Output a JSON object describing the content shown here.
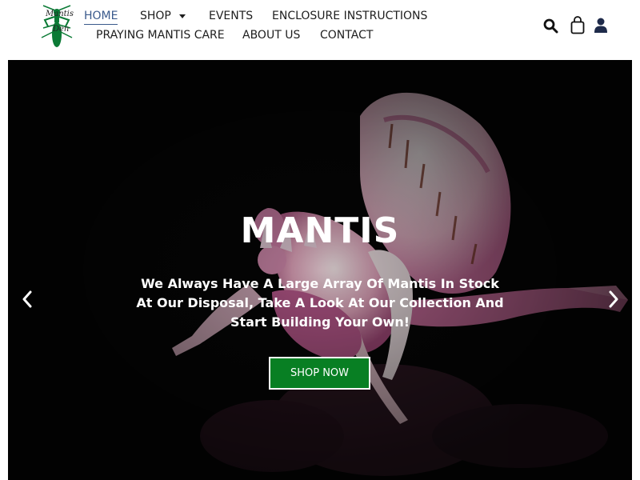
{
  "logo": {
    "name": "mantis-logo",
    "text": "Mantis Den"
  },
  "nav": {
    "home": "HOME",
    "shop": "SHOP",
    "events": "EVENTS",
    "enclosure": "ENCLOSURE INSTRUCTIONS",
    "care": "PRAYING MANTIS CARE",
    "about": "ABOUT US",
    "contact": "CONTACT"
  },
  "header_icons": [
    "search-icon",
    "cart-icon",
    "user-icon"
  ],
  "hero": {
    "title": "MANTIS",
    "subtitle": "We Always Have A Large Array Of Mantis In Stock At Our Disposal, Take A Look At Our Collection And Start Building Your Own!",
    "button": "SHOP NOW"
  },
  "colors": {
    "brand_green": "#087f23",
    "active_nav": "#3a5a8c",
    "icon_navy": "#1e2a4a",
    "hero_background": "#050505"
  }
}
